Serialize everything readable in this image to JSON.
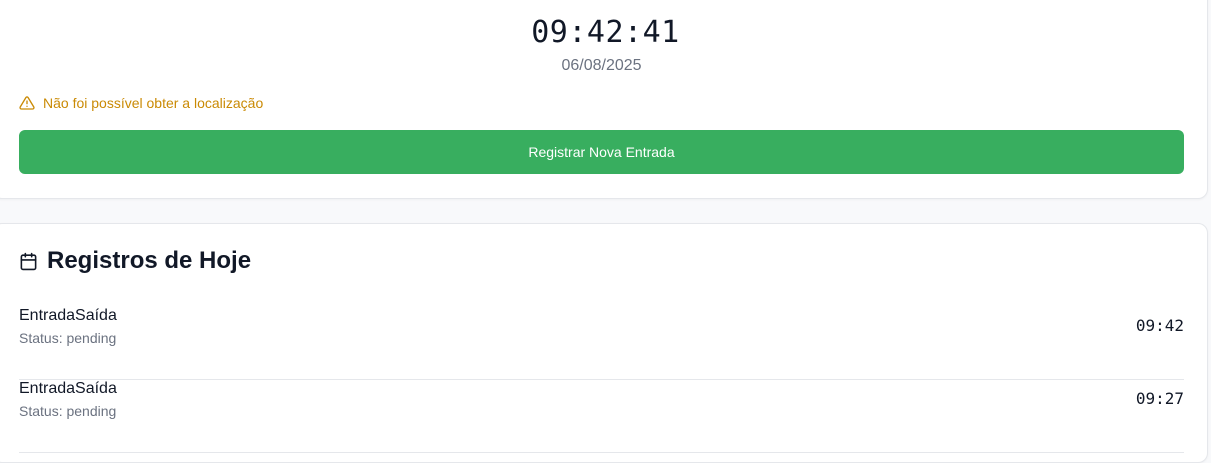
{
  "clock": {
    "time": "09:42:41",
    "date": "06/08/2025"
  },
  "location_warning": {
    "icon": "warning-triangle-icon",
    "text": "Não foi possível obter a localização",
    "color": "#ca8a04"
  },
  "register_button": {
    "label": "Registrar Nova Entrada",
    "color": "#38ae5f"
  },
  "today_section": {
    "icon": "calendar-icon",
    "title": "Registros de Hoje",
    "records": [
      {
        "type": "EntradaSaída",
        "status": "Status: pending",
        "time": "09:42"
      },
      {
        "type": "EntradaSaída",
        "status": "Status: pending",
        "time": "09:27"
      }
    ]
  }
}
